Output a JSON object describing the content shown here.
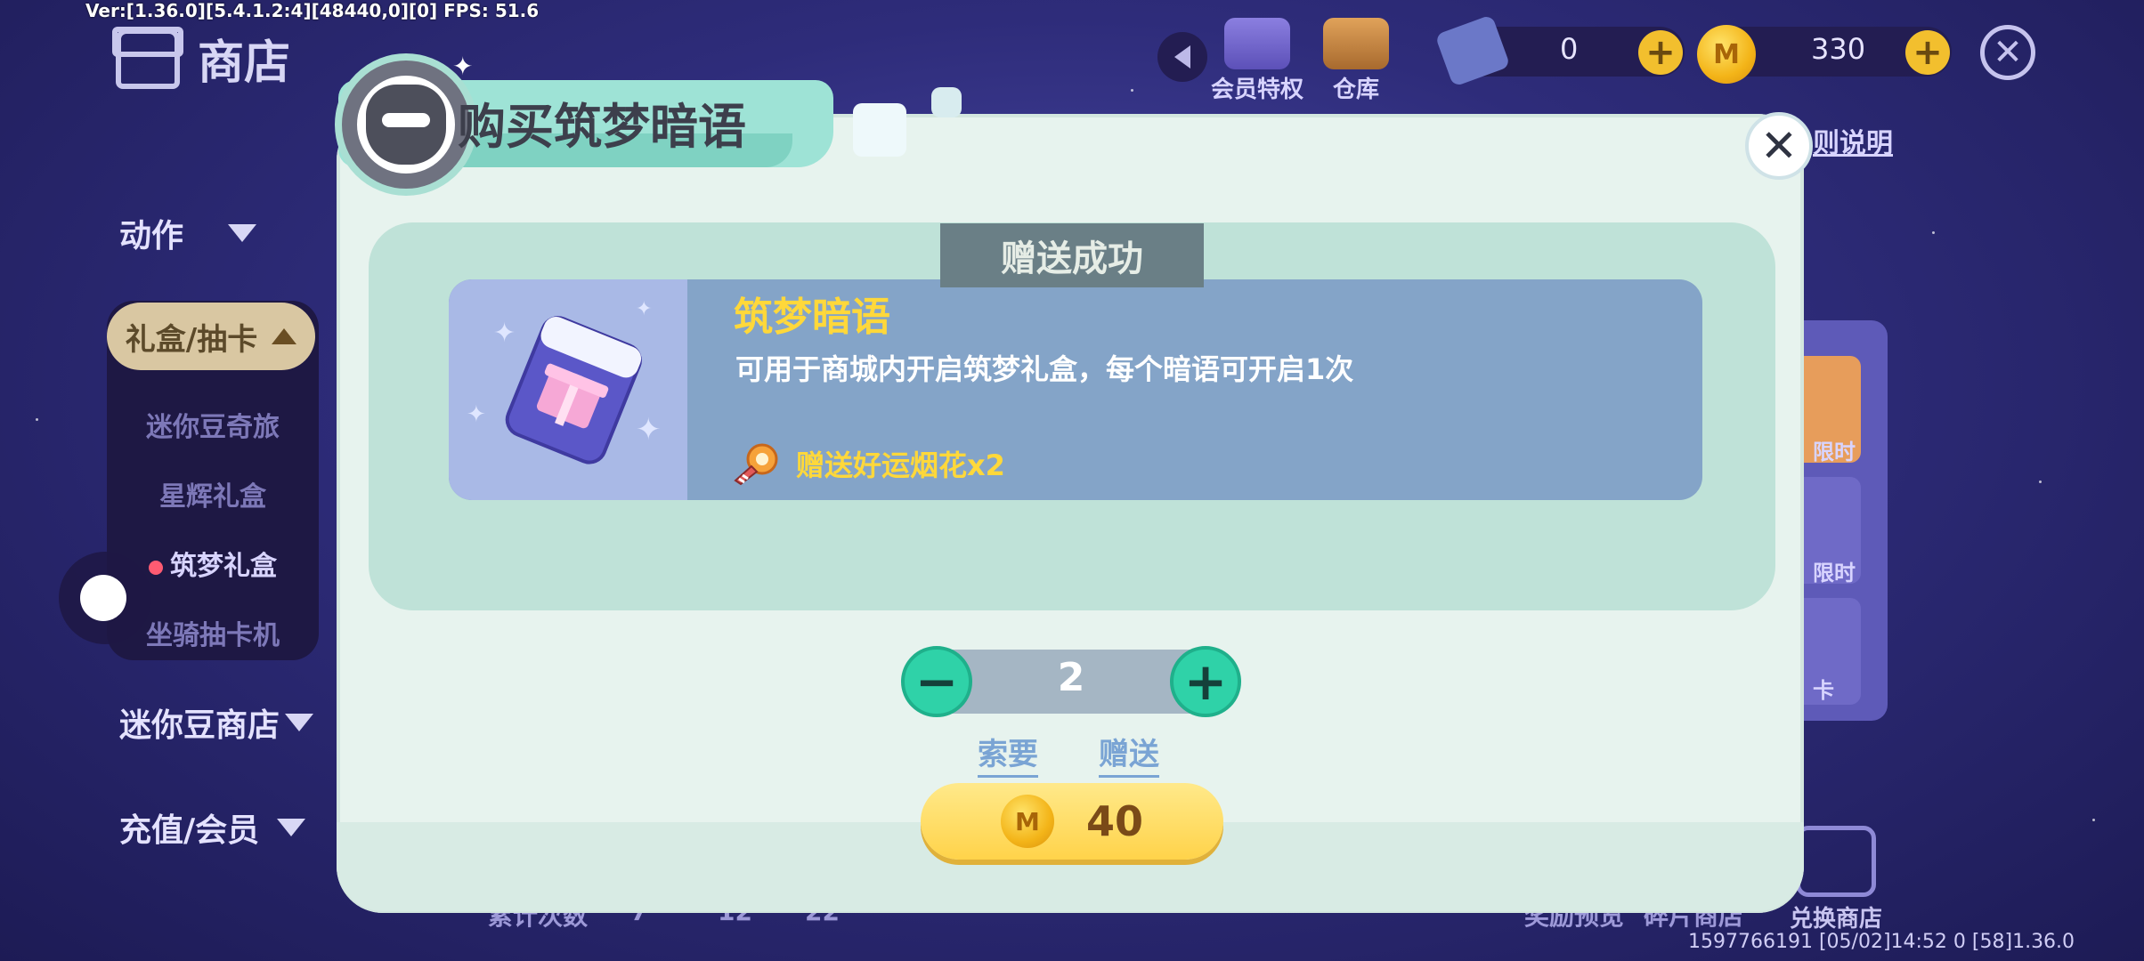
{
  "debug_text": "Ver:[1.36.0][5.4.1.2:4][48440,0][0] FPS: 51.6",
  "shop": {
    "title": "商店"
  },
  "sidebar": {
    "action": "动作",
    "giftbox": "礼盒/抽卡",
    "sub_items": [
      "迷你豆奇旅",
      "星辉礼盒",
      "筑梦礼盒",
      "坐骑抽卡机"
    ],
    "active_sub_index": 2,
    "mini_bean_shop": "迷你豆商店",
    "recharge": "充值/会员"
  },
  "topbar": {
    "vip_label": "会员特权",
    "warehouse_label": "仓库",
    "ticket_count": "0",
    "coin_count": "330",
    "plus_glyph": "+",
    "close_glyph": "✕"
  },
  "background": {
    "rules_link": "则说明",
    "card_labels": [
      "限时",
      "限时",
      "卡"
    ],
    "exchange_label": "兑换商店",
    "bottom_row": [
      "累计次数",
      "7",
      "12",
      "22",
      "奖励预览",
      "碎片商店"
    ],
    "build_info": "1597766191  [05/02]14:52 0  [58]1.36.0"
  },
  "modal": {
    "title": "购买筑梦暗语",
    "close_glyph": "✕",
    "toast": "赠送成功",
    "item": {
      "name": "筑梦暗语",
      "description": "可用于商城内开启筑梦礼盒，每个暗语可开启1次",
      "bonus": "赠送好运烟花x2"
    },
    "stepper": {
      "minus": "−",
      "plus": "+",
      "value": "2"
    },
    "links": {
      "request": "索要",
      "gift": "赠送"
    },
    "price": "40",
    "coin_glyph": "M"
  },
  "colors": {
    "accent_green": "#2fd2a8",
    "gold": "#ffd83a",
    "modal_bg": "#e7f3ee"
  }
}
